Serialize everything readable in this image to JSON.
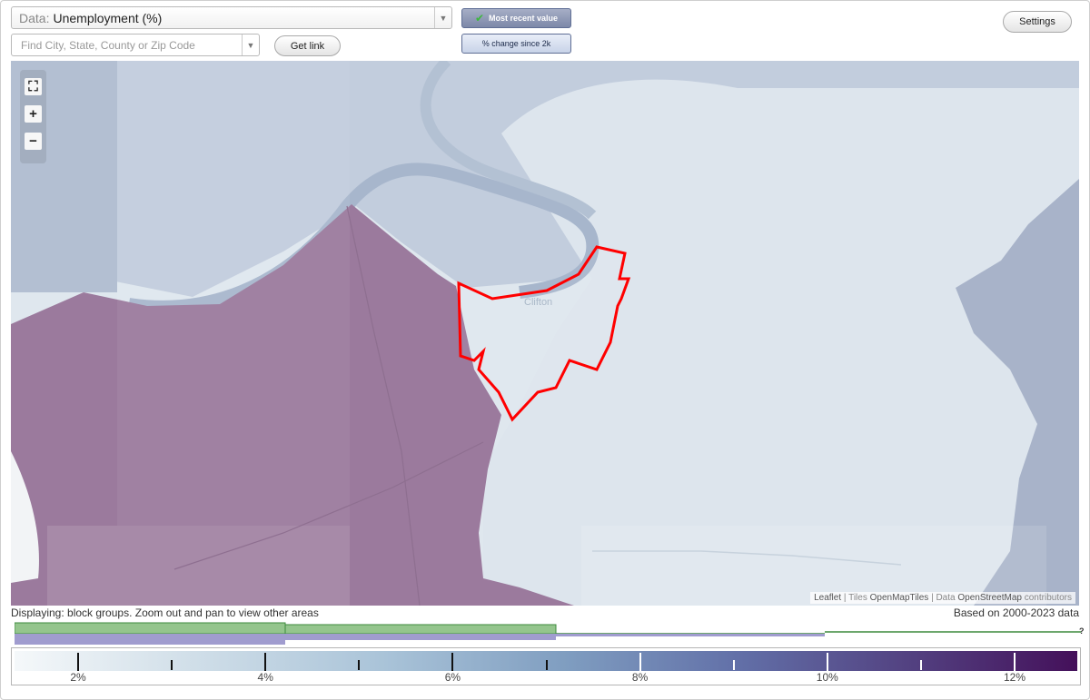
{
  "controls": {
    "data_prefix": "Data:",
    "data_value": "Unemployment (%)",
    "search_placeholder": "Find City, State, County or Zip Code",
    "get_link": "Get link",
    "most_recent": "Most recent value",
    "pct_change": "% change since 2k",
    "settings": "Settings"
  },
  "map": {
    "place_label": "Clifton",
    "zoom_in": "+",
    "zoom_out": "−",
    "attribution": {
      "leaflet": "Leaflet",
      "tiles_prefix": "Tiles",
      "tiles": "OpenMapTiles",
      "data_prefix": "Data",
      "data": "OpenStreetMap",
      "suffix": "contributors"
    }
  },
  "footer": {
    "displaying": "Displaying: block groups. Zoom out and pan to view other areas",
    "based_on": "Based on 2000-2023 data",
    "question_mark": "?"
  },
  "legend": {
    "ticks": [
      {
        "value": 2,
        "label": "2%"
      },
      {
        "value": 3,
        "label": ""
      },
      {
        "value": 4,
        "label": "4%"
      },
      {
        "value": 5,
        "label": ""
      },
      {
        "value": 6,
        "label": "6%"
      },
      {
        "value": 7,
        "label": ""
      },
      {
        "value": 8,
        "label": "8%"
      },
      {
        "value": 9,
        "label": ""
      },
      {
        "value": 10,
        "label": "10%"
      },
      {
        "value": 11,
        "label": ""
      },
      {
        "value": 12,
        "label": "12%"
      }
    ]
  },
  "colors": {
    "highlight_outline": "#ff0000",
    "purple_region": "#9b7a9d",
    "blue_region": "#aab4cb",
    "toggle_active": "#8d97b4"
  }
}
